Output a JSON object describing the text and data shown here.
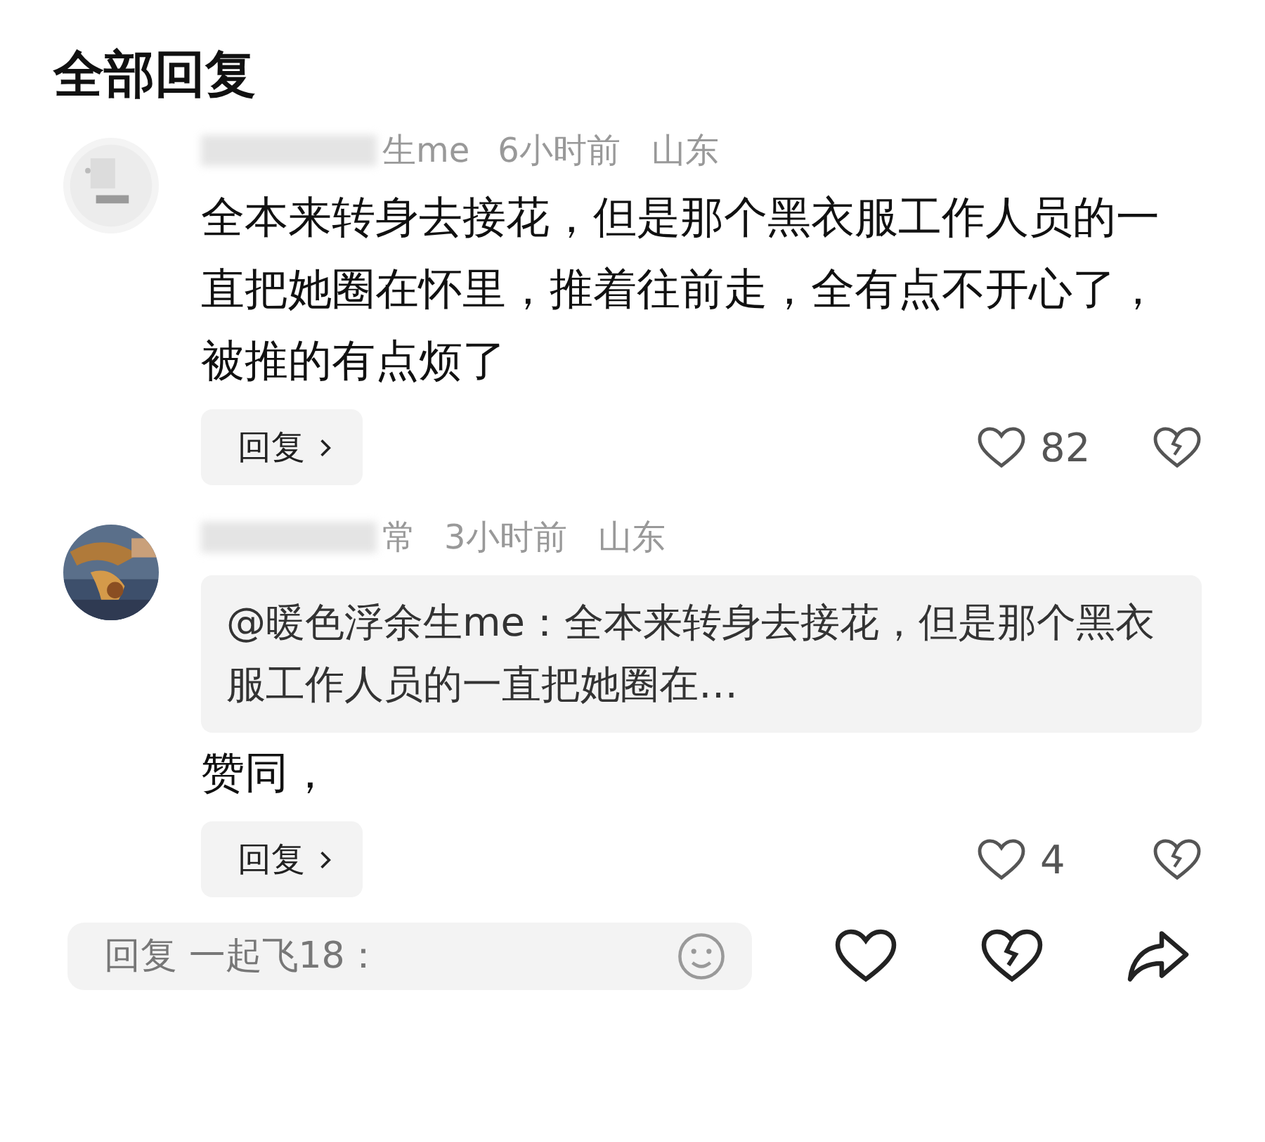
{
  "title": "全部回复",
  "comments": [
    {
      "name": "生me",
      "time": "6小时前",
      "location": "山东",
      "body": "全本来转身去接花，但是那个黑衣服工作人员的一直把她圈在怀里，推着往前走，全有点不开心了，被推的有点烦了",
      "reply_label": "回复",
      "likes": "82",
      "liked": false
    },
    {
      "name": "常",
      "time": "3小时前",
      "location": "山东",
      "quote": "@暖色浮余生me：全本来转身去接花，但是那个黑衣服工作人员的一直把她圈在…",
      "body": "赞同，",
      "reply_label": "回复",
      "likes": "4",
      "liked": false
    }
  ],
  "bottom_bar": {
    "placeholder": "回复 一起飞18："
  }
}
